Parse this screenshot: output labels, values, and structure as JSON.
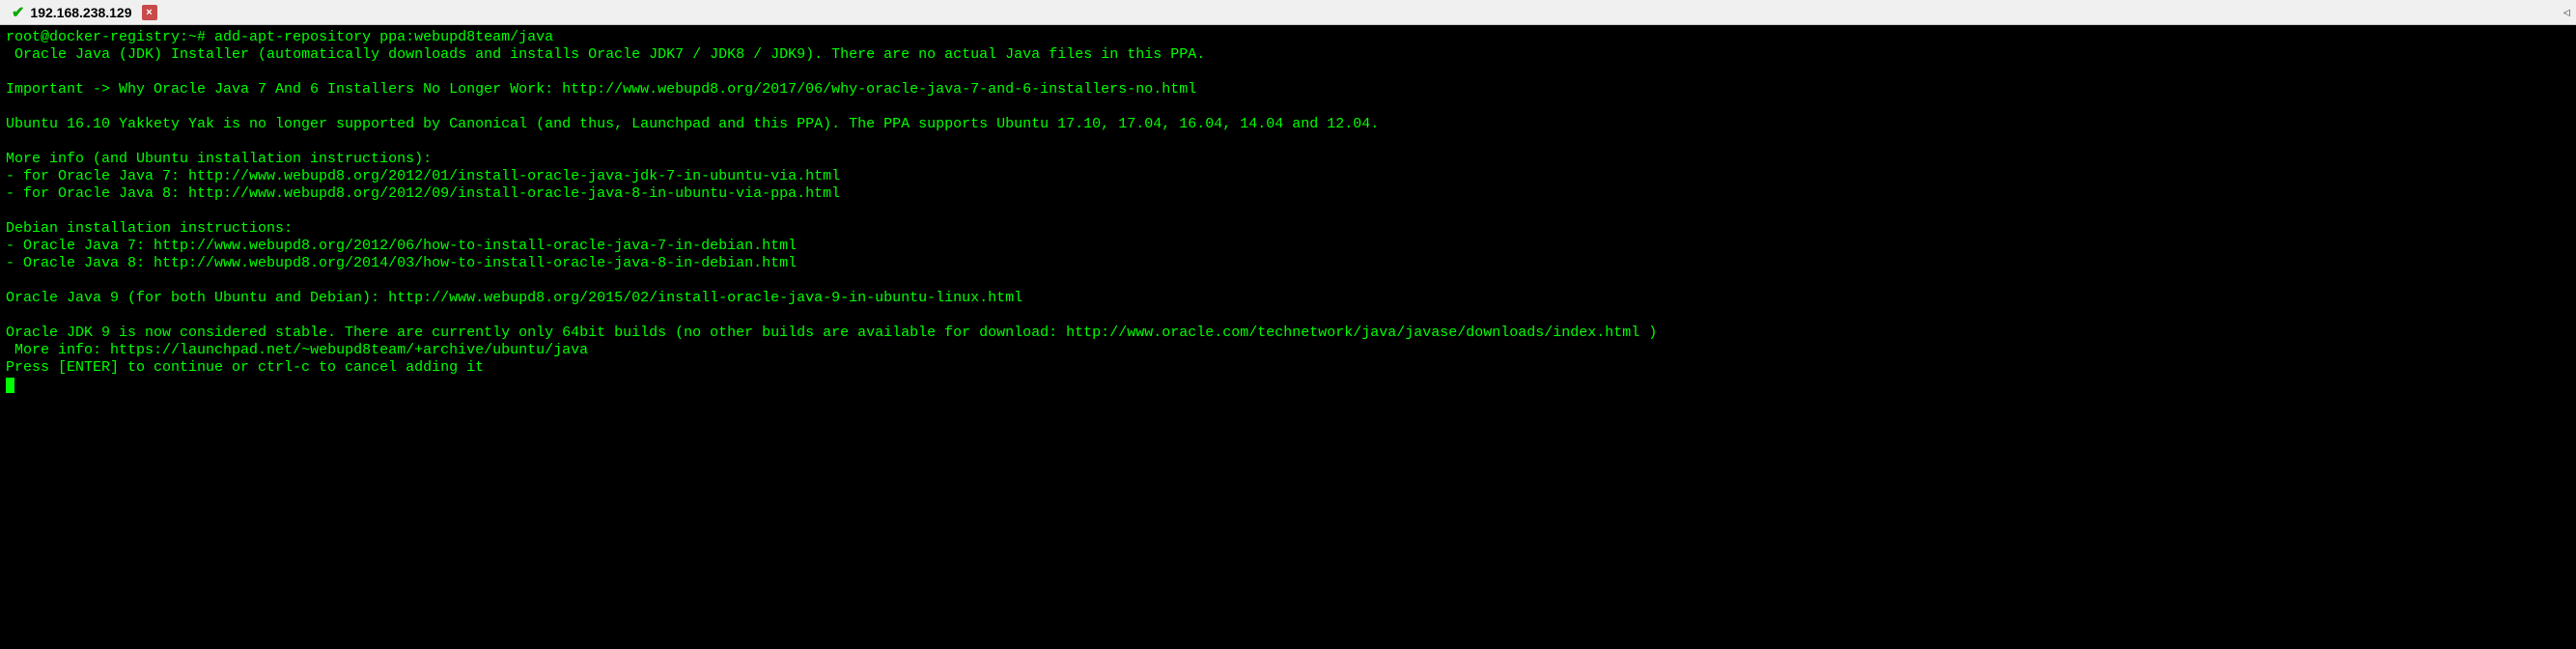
{
  "tab": {
    "title": "192.168.238.129",
    "close_label": "×"
  },
  "terminal": {
    "prompt": "root@docker-registry:~# ",
    "command": "add-apt-repository ppa:webupd8team/java",
    "lines": [
      " Oracle Java (JDK) Installer (automatically downloads and installs Oracle JDK7 / JDK8 / JDK9). There are no actual Java files in this PPA.",
      "",
      "Important -> Why Oracle Java 7 And 6 Installers No Longer Work: http://www.webupd8.org/2017/06/why-oracle-java-7-and-6-installers-no.html",
      "",
      "Ubuntu 16.10 Yakkety Yak is no longer supported by Canonical (and thus, Launchpad and this PPA). The PPA supports Ubuntu 17.10, 17.04, 16.04, 14.04 and 12.04.",
      "",
      "More info (and Ubuntu installation instructions):",
      "- for Oracle Java 7: http://www.webupd8.org/2012/01/install-oracle-java-jdk-7-in-ubuntu-via.html",
      "- for Oracle Java 8: http://www.webupd8.org/2012/09/install-oracle-java-8-in-ubuntu-via-ppa.html",
      "",
      "Debian installation instructions:",
      "- Oracle Java 7: http://www.webupd8.org/2012/06/how-to-install-oracle-java-7-in-debian.html",
      "- Oracle Java 8: http://www.webupd8.org/2014/03/how-to-install-oracle-java-8-in-debian.html",
      "",
      "Oracle Java 9 (for both Ubuntu and Debian): http://www.webupd8.org/2015/02/install-oracle-java-9-in-ubuntu-linux.html",
      "",
      "Oracle JDK 9 is now considered stable. There are currently only 64bit builds (no other builds are available for download: http://www.oracle.com/technetwork/java/javase/downloads/index.html )",
      " More info: https://launchpad.net/~webupd8team/+archive/ubuntu/java",
      "Press [ENTER] to continue or ctrl-c to cancel adding it"
    ]
  }
}
